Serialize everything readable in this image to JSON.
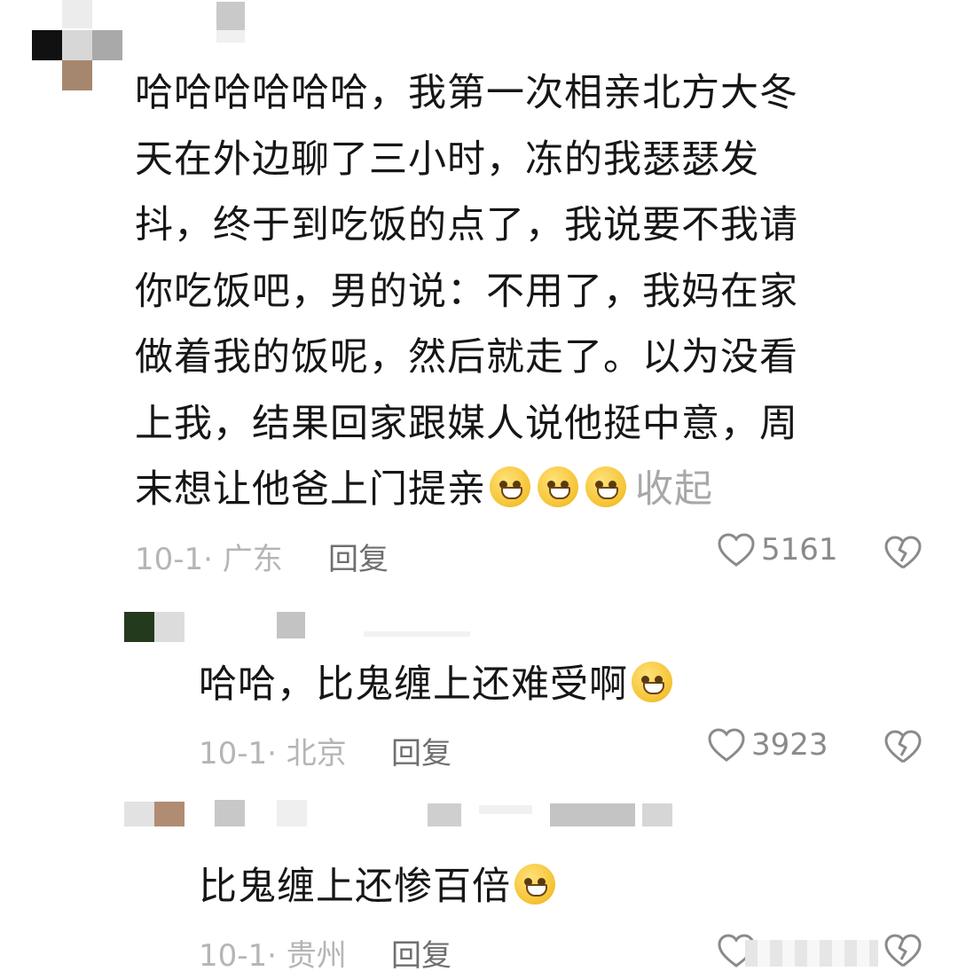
{
  "comments": [
    {
      "text": "哈哈哈哈哈哈，我第一次相亲北方大冬天在外边聊了三小时，冻的我瑟瑟发抖，终于到吃饭的点了，我说要不我请你吃饭吧，男的说：不用了，我妈在家做着我的饭呢，然后就走了。以为没看上我，结果回家跟媒人说他挺中意，周末想让他爸上门提亲",
      "lines": [
        "哈哈哈哈哈哈，我第一次相亲北方大冬",
        "天在外边聊了三小时，冻的我瑟瑟发",
        "抖，终于到吃饭的点了，我说要不我请",
        "你吃饭吧，男的说：不用了，我妈在家",
        "做着我的饭呢，然后就走了。以为没看",
        "上我，结果回家跟媒人说他挺中意，周",
        "末想让他爸上门提亲"
      ],
      "emoji": "cold-sweat-emoji",
      "collapse_label": "收起",
      "meta": "10-1· 广东",
      "reply_label": "回复",
      "likes": "5161"
    },
    {
      "text": "哈哈，比鬼缠上还难受啊",
      "emoji": "grin-sweat-emoji",
      "meta": "10-1· 北京",
      "reply_label": "回复",
      "likes": "3923"
    },
    {
      "text": "比鬼缠上还惨百倍",
      "emoji": "grin-emoji",
      "meta": "10-1· 贵州",
      "reply_label": "回复",
      "likes": ""
    }
  ],
  "colors": {
    "text": "#161616",
    "meta": "#b5b5b5",
    "reply": "#6f6f6f",
    "icon": "#8a8a8a"
  }
}
